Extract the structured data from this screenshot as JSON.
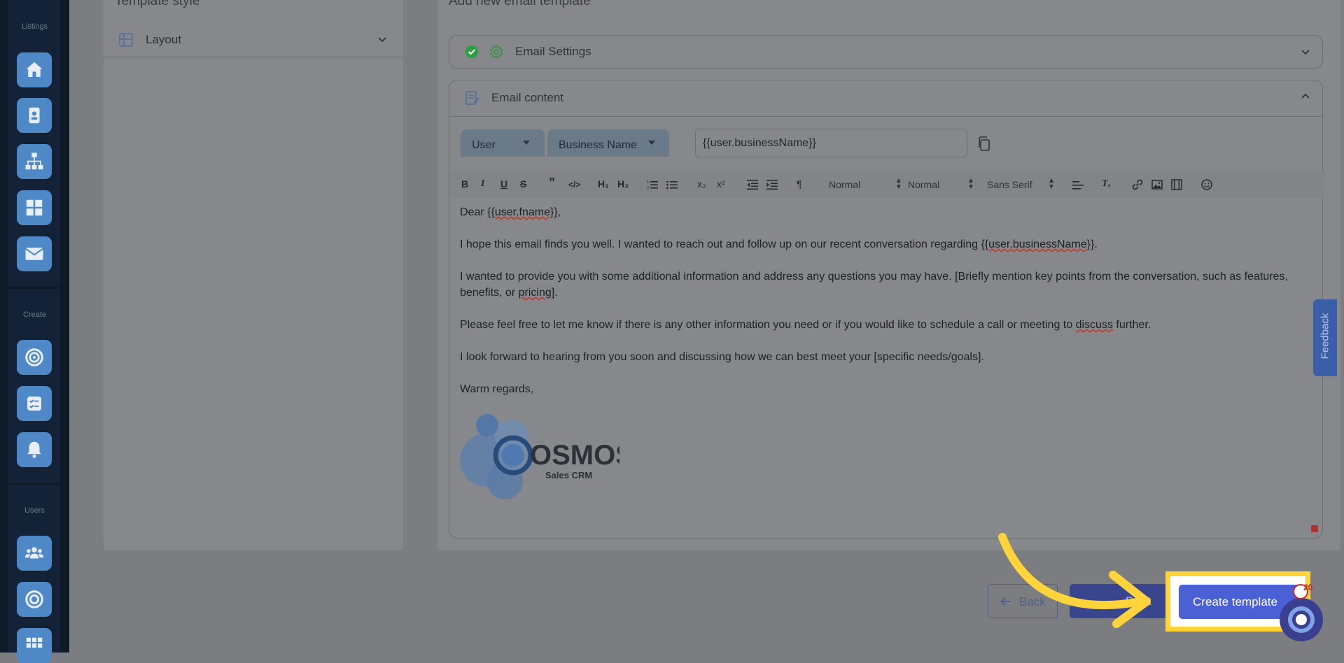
{
  "sidebar": {
    "sections": [
      {
        "label": "Listings"
      },
      {
        "label": "Create"
      },
      {
        "label": "Users"
      }
    ],
    "icons": [
      "home-icon",
      "contact-card-icon",
      "org-chart-icon",
      "grid-icon",
      "mail-icon",
      "target-icon",
      "checklist-icon",
      "bell-icon",
      "group-icon",
      "bullseye-icon",
      "apps-grid-icon"
    ]
  },
  "left_panel": {
    "title": "Template style",
    "layout_label": "Layout"
  },
  "main_panel": {
    "title": "Add new email template",
    "email_settings_label": "Email Settings",
    "email_content_label": "Email content",
    "variable": {
      "category": "User",
      "field": "Business Name",
      "value": "{{user.businessName}}"
    },
    "toolbar": {
      "bold": "B",
      "italic": "I",
      "underline": "U",
      "strike": "S",
      "quote": "”",
      "code": "</>",
      "h1": "H₁",
      "h2": "H₂",
      "subscript": "x₂",
      "superscript": "x²",
      "rtl": "¶",
      "size_select": "Normal",
      "header_select": "Normal",
      "font_select": "Sans Serif",
      "clear": "Tₓ"
    },
    "body": {
      "greeting_prefix": "Dear ",
      "greeting_var": "{{user.fname}}",
      "greeting_suffix": ",",
      "p1_prefix": "I hope this email finds you well. I wanted to reach out and follow up on our recent conversation regarding ",
      "p1_var": "{{user.businessName}}",
      "p1_suffix": ".",
      "p2_prefix": "I wanted to provide you with some additional information and address any questions you may have. [Briefly mention key points from the conversation, such as features, benefits, or ",
      "p2_var": "pricing]",
      "p2_suffix": ".",
      "p3_prefix": "Please feel free to let me know if there is any other information you need or if you would like to schedule a call or meeting to ",
      "p3_var": "discuss",
      "p3_suffix": " further.",
      "p4": "I look forward to hearing from you soon and discussing how we can best meet your [specific needs/goals].",
      "closing": "Warm regards,"
    },
    "logo": {
      "brand": "OSMOS",
      "tagline": "Sales CRM"
    }
  },
  "footer": {
    "back_label": "Back",
    "draft_label": "Draft",
    "create_label": "Create template"
  },
  "feedback_label": "Feedback",
  "chat_badge_count": "20",
  "colors": {
    "accent": "#4c60d6",
    "highlight": "#ffd43b",
    "sidebar": "#132236",
    "success": "#2e9e3e"
  }
}
